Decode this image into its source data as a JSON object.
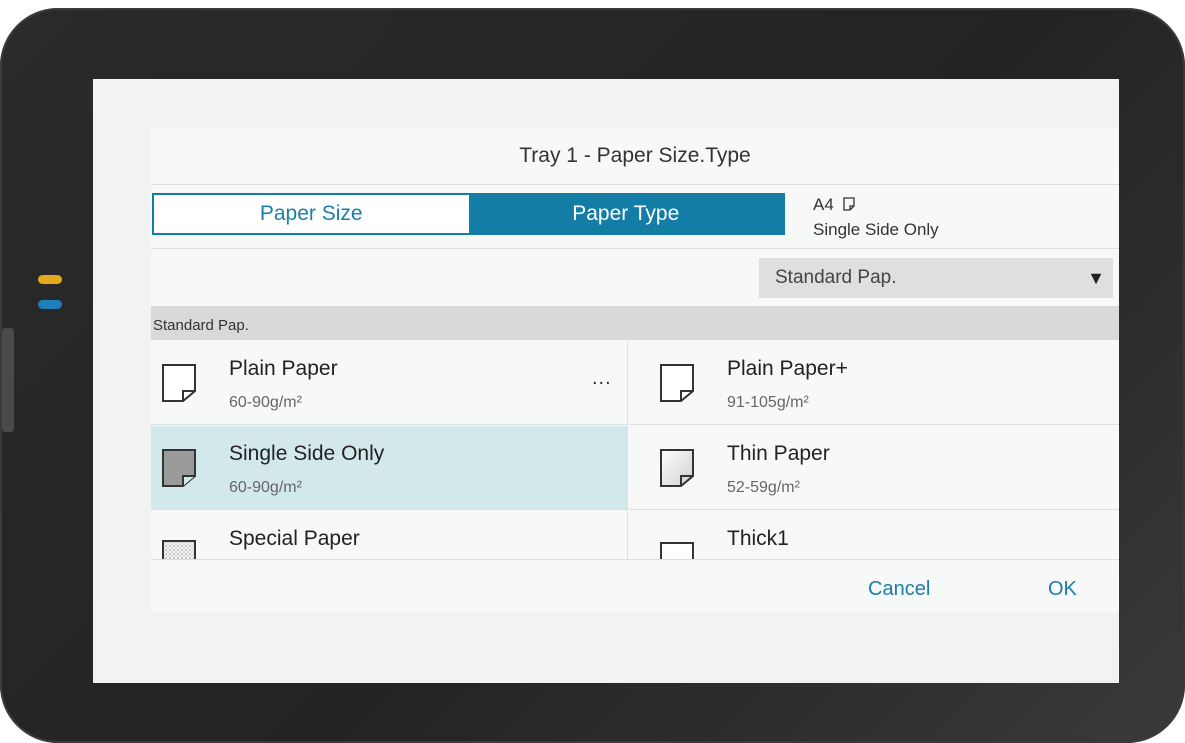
{
  "dialog": {
    "title": "Tray 1 - Paper Size.Type",
    "tabs": [
      {
        "label": "Paper Size",
        "active": false
      },
      {
        "label": "Paper Type",
        "active": true
      }
    ],
    "status": {
      "size": "A4",
      "mode": "Single Side Only"
    },
    "dropdown": {
      "selected": "Standard Pap."
    },
    "section_label": "Standard Pap.",
    "items": [
      {
        "name": "Plain Paper",
        "weight": "60-90g/m²",
        "more": "..."
      },
      {
        "name": "Plain Paper+",
        "weight": "91-105g/m²"
      },
      {
        "name": "Single Side Only",
        "weight": "60-90g/m²",
        "selected": true
      },
      {
        "name": "Thin Paper",
        "weight": "52-59g/m²"
      },
      {
        "name": "Special Paper",
        "weight": ""
      },
      {
        "name": "Thick1",
        "weight": ""
      }
    ],
    "buttons": {
      "cancel": "Cancel",
      "ok": "OK"
    }
  },
  "colors": {
    "accent": "#147da6",
    "selected_row": "#d3e8ea",
    "led_yellow": "#e2a91d",
    "led_blue": "#1f7fba"
  }
}
